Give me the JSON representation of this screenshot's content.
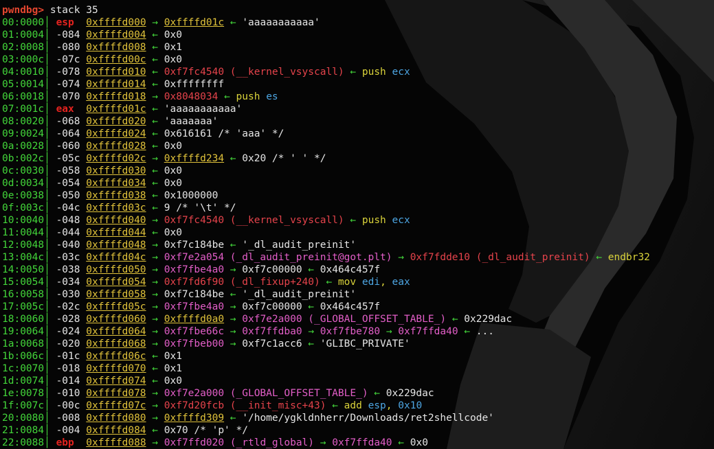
{
  "prompt": "pwndbg>",
  "command": "stack 35",
  "rows": [
    {
      "idx": "00:0000",
      "reg": "esp",
      "off": "",
      "addr": "0xffffd000",
      "chain": [
        {
          "t": " "
        },
        {
          "t": "→",
          "c": "arrow"
        },
        {
          "t": " "
        },
        {
          "t": "0xffffd01c",
          "c": "addr"
        },
        {
          "t": " "
        },
        {
          "t": "←",
          "c": "arrow"
        },
        {
          "t": " 'aaaaaaaaaaa'",
          "c": "val"
        }
      ]
    },
    {
      "idx": "01:0004",
      "reg": "",
      "off": "-084",
      "addr": "0xffffd004",
      "chain": [
        {
          "t": " "
        },
        {
          "t": "←",
          "c": "arrow"
        },
        {
          "t": " 0x0",
          "c": "val"
        }
      ]
    },
    {
      "idx": "02:0008",
      "reg": "",
      "off": "-080",
      "addr": "0xffffd008",
      "chain": [
        {
          "t": " "
        },
        {
          "t": "←",
          "c": "arrow"
        },
        {
          "t": " 0x1",
          "c": "val"
        }
      ]
    },
    {
      "idx": "03:000c",
      "reg": "",
      "off": "-07c",
      "addr": "0xffffd00c",
      "chain": [
        {
          "t": " "
        },
        {
          "t": "←",
          "c": "arrow"
        },
        {
          "t": " 0x0",
          "c": "val"
        }
      ]
    },
    {
      "idx": "04:0010",
      "reg": "",
      "off": "-078",
      "addr": "0xffffd010",
      "chain": [
        {
          "t": " "
        },
        {
          "t": "←",
          "c": "arrow"
        },
        {
          "t": " "
        },
        {
          "t": "0xf7fc4540 (__kernel_vsyscall)",
          "c": "ptr-r"
        },
        {
          "t": " "
        },
        {
          "t": "←",
          "c": "arrow"
        },
        {
          "t": " push ",
          "c": "instr"
        },
        {
          "t": "ecx",
          "c": "regop"
        }
      ]
    },
    {
      "idx": "05:0014",
      "reg": "",
      "off": "-074",
      "addr": "0xffffd014",
      "chain": [
        {
          "t": " "
        },
        {
          "t": "←",
          "c": "arrow"
        },
        {
          "t": " 0xffffffff",
          "c": "val"
        }
      ]
    },
    {
      "idx": "06:0018",
      "reg": "",
      "off": "-070",
      "addr": "0xffffd018",
      "chain": [
        {
          "t": " "
        },
        {
          "t": "→",
          "c": "arrow"
        },
        {
          "t": " "
        },
        {
          "t": "0x8048034",
          "c": "ptr-r"
        },
        {
          "t": " "
        },
        {
          "t": "←",
          "c": "arrow"
        },
        {
          "t": " push ",
          "c": "instr"
        },
        {
          "t": "es",
          "c": "regop"
        }
      ]
    },
    {
      "idx": "07:001c",
      "reg": "eax",
      "off": "",
      "addr": "0xffffd01c",
      "chain": [
        {
          "t": " "
        },
        {
          "t": "←",
          "c": "arrow"
        },
        {
          "t": " 'aaaaaaaaaaa'",
          "c": "val"
        }
      ]
    },
    {
      "idx": "08:0020",
      "reg": "",
      "off": "-068",
      "addr": "0xffffd020",
      "chain": [
        {
          "t": " "
        },
        {
          "t": "←",
          "c": "arrow"
        },
        {
          "t": " 'aaaaaaa'",
          "c": "val"
        }
      ]
    },
    {
      "idx": "09:0024",
      "reg": "",
      "off": "-064",
      "addr": "0xffffd024",
      "chain": [
        {
          "t": " "
        },
        {
          "t": "←",
          "c": "arrow"
        },
        {
          "t": " 0x616161 /* 'aaa' */",
          "c": "val"
        }
      ]
    },
    {
      "idx": "0a:0028",
      "reg": "",
      "off": "-060",
      "addr": "0xffffd028",
      "chain": [
        {
          "t": " "
        },
        {
          "t": "←",
          "c": "arrow"
        },
        {
          "t": " 0x0",
          "c": "val"
        }
      ]
    },
    {
      "idx": "0b:002c",
      "reg": "",
      "off": "-05c",
      "addr": "0xffffd02c",
      "chain": [
        {
          "t": " "
        },
        {
          "t": "→",
          "c": "arrow"
        },
        {
          "t": " "
        },
        {
          "t": "0xffffd234",
          "c": "addr"
        },
        {
          "t": " "
        },
        {
          "t": "←",
          "c": "arrow"
        },
        {
          "t": " 0x20 /* ' ' */",
          "c": "val"
        }
      ]
    },
    {
      "idx": "0c:0030",
      "reg": "",
      "off": "-058",
      "addr": "0xffffd030",
      "chain": [
        {
          "t": " "
        },
        {
          "t": "←",
          "c": "arrow"
        },
        {
          "t": " 0x0",
          "c": "val"
        }
      ]
    },
    {
      "idx": "0d:0034",
      "reg": "",
      "off": "-054",
      "addr": "0xffffd034",
      "chain": [
        {
          "t": " "
        },
        {
          "t": "←",
          "c": "arrow"
        },
        {
          "t": " 0x0",
          "c": "val"
        }
      ]
    },
    {
      "idx": "0e:0038",
      "reg": "",
      "off": "-050",
      "addr": "0xffffd038",
      "chain": [
        {
          "t": " "
        },
        {
          "t": "←",
          "c": "arrow"
        },
        {
          "t": " 0x1000000",
          "c": "val"
        }
      ]
    },
    {
      "idx": "0f:003c",
      "reg": "",
      "off": "-04c",
      "addr": "0xffffd03c",
      "chain": [
        {
          "t": " "
        },
        {
          "t": "←",
          "c": "arrow"
        },
        {
          "t": " 9 /* '\\t' */",
          "c": "val"
        }
      ]
    },
    {
      "idx": "10:0040",
      "reg": "",
      "off": "-048",
      "addr": "0xffffd040",
      "chain": [
        {
          "t": " "
        },
        {
          "t": "→",
          "c": "arrow"
        },
        {
          "t": " "
        },
        {
          "t": "0xf7fc4540 (__kernel_vsyscall)",
          "c": "ptr-r"
        },
        {
          "t": " "
        },
        {
          "t": "←",
          "c": "arrow"
        },
        {
          "t": " push ",
          "c": "instr"
        },
        {
          "t": "ecx",
          "c": "regop"
        }
      ]
    },
    {
      "idx": "11:0044",
      "reg": "",
      "off": "-044",
      "addr": "0xffffd044",
      "chain": [
        {
          "t": " "
        },
        {
          "t": "←",
          "c": "arrow"
        },
        {
          "t": " 0x0",
          "c": "val"
        }
      ]
    },
    {
      "idx": "12:0048",
      "reg": "",
      "off": "-040",
      "addr": "0xffffd048",
      "chain": [
        {
          "t": " "
        },
        {
          "t": "→",
          "c": "arrow"
        },
        {
          "t": " 0xf7c184be ",
          "c": "val"
        },
        {
          "t": "←",
          "c": "arrow"
        },
        {
          "t": " '_dl_audit_preinit'",
          "c": "val"
        }
      ]
    },
    {
      "idx": "13:004c",
      "reg": "",
      "off": "-03c",
      "addr": "0xffffd04c",
      "chain": [
        {
          "t": " "
        },
        {
          "t": "→",
          "c": "arrow"
        },
        {
          "t": " "
        },
        {
          "t": "0xf7e2a054 (_dl_audit_preinit@got.plt)",
          "c": "ptr-m"
        },
        {
          "t": " "
        },
        {
          "t": "→",
          "c": "arrow"
        },
        {
          "t": " "
        },
        {
          "t": "0xf7fdde10 (_dl_audit_preinit)",
          "c": "ptr-r"
        },
        {
          "t": " "
        },
        {
          "t": "←",
          "c": "arrow"
        },
        {
          "t": " endbr32",
          "c": "instr"
        }
      ]
    },
    {
      "idx": "14:0050",
      "reg": "",
      "off": "-038",
      "addr": "0xffffd050",
      "chain": [
        {
          "t": " "
        },
        {
          "t": "→",
          "c": "arrow"
        },
        {
          "t": " "
        },
        {
          "t": "0xf7fbe4a0",
          "c": "ptr-m"
        },
        {
          "t": " "
        },
        {
          "t": "→",
          "c": "arrow"
        },
        {
          "t": " 0xf7c00000 ",
          "c": "val"
        },
        {
          "t": "←",
          "c": "arrow"
        },
        {
          "t": " 0x464c457f",
          "c": "val"
        }
      ]
    },
    {
      "idx": "15:0054",
      "reg": "",
      "off": "-034",
      "addr": "0xffffd054",
      "chain": [
        {
          "t": " "
        },
        {
          "t": "→",
          "c": "arrow"
        },
        {
          "t": " "
        },
        {
          "t": "0xf7fd6f90 (_dl_fixup+240)",
          "c": "ptr-r"
        },
        {
          "t": " "
        },
        {
          "t": "←",
          "c": "arrow"
        },
        {
          "t": " mov ",
          "c": "instr"
        },
        {
          "t": "edi",
          "c": "regop"
        },
        {
          "t": ", ",
          "c": "instr"
        },
        {
          "t": "eax",
          "c": "regop"
        }
      ]
    },
    {
      "idx": "16:0058",
      "reg": "",
      "off": "-030",
      "addr": "0xffffd058",
      "chain": [
        {
          "t": " "
        },
        {
          "t": "→",
          "c": "arrow"
        },
        {
          "t": " 0xf7c184be ",
          "c": "val"
        },
        {
          "t": "←",
          "c": "arrow"
        },
        {
          "t": " '_dl_audit_preinit'",
          "c": "val"
        }
      ]
    },
    {
      "idx": "17:005c",
      "reg": "",
      "off": "-02c",
      "addr": "0xffffd05c",
      "chain": [
        {
          "t": " "
        },
        {
          "t": "→",
          "c": "arrow"
        },
        {
          "t": " "
        },
        {
          "t": "0xf7fbe4a0",
          "c": "ptr-m"
        },
        {
          "t": " "
        },
        {
          "t": "→",
          "c": "arrow"
        },
        {
          "t": " 0xf7c00000 ",
          "c": "val"
        },
        {
          "t": "←",
          "c": "arrow"
        },
        {
          "t": " 0x464c457f",
          "c": "val"
        }
      ]
    },
    {
      "idx": "18:0060",
      "reg": "",
      "off": "-028",
      "addr": "0xffffd060",
      "chain": [
        {
          "t": " "
        },
        {
          "t": "→",
          "c": "arrow"
        },
        {
          "t": " "
        },
        {
          "t": "0xffffd0a0",
          "c": "addr"
        },
        {
          "t": " "
        },
        {
          "t": "→",
          "c": "arrow"
        },
        {
          "t": " "
        },
        {
          "t": "0xf7e2a000 (_GLOBAL_OFFSET_TABLE_)",
          "c": "ptr-m"
        },
        {
          "t": " "
        },
        {
          "t": "←",
          "c": "arrow"
        },
        {
          "t": " 0x229dac",
          "c": "val"
        }
      ]
    },
    {
      "idx": "19:0064",
      "reg": "",
      "off": "-024",
      "addr": "0xffffd064",
      "chain": [
        {
          "t": " "
        },
        {
          "t": "→",
          "c": "arrow"
        },
        {
          "t": " "
        },
        {
          "t": "0xf7fbe66c",
          "c": "ptr-m"
        },
        {
          "t": " "
        },
        {
          "t": "→",
          "c": "arrow"
        },
        {
          "t": " "
        },
        {
          "t": "0xf7ffdba0",
          "c": "ptr-m"
        },
        {
          "t": " "
        },
        {
          "t": "→",
          "c": "arrow"
        },
        {
          "t": " "
        },
        {
          "t": "0xf7fbe780",
          "c": "ptr-m"
        },
        {
          "t": " "
        },
        {
          "t": "→",
          "c": "arrow"
        },
        {
          "t": " "
        },
        {
          "t": "0xf7ffda40",
          "c": "ptr-m"
        },
        {
          "t": " "
        },
        {
          "t": "←",
          "c": "arrow"
        },
        {
          "t": " ...",
          "c": "val"
        }
      ]
    },
    {
      "idx": "1a:0068",
      "reg": "",
      "off": "-020",
      "addr": "0xffffd068",
      "chain": [
        {
          "t": " "
        },
        {
          "t": "→",
          "c": "arrow"
        },
        {
          "t": " "
        },
        {
          "t": "0xf7fbeb00",
          "c": "ptr-m"
        },
        {
          "t": " "
        },
        {
          "t": "→",
          "c": "arrow"
        },
        {
          "t": " 0xf7c1acc6 ",
          "c": "val"
        },
        {
          "t": "←",
          "c": "arrow"
        },
        {
          "t": " 'GLIBC_PRIVATE'",
          "c": "val"
        }
      ]
    },
    {
      "idx": "1b:006c",
      "reg": "",
      "off": "-01c",
      "addr": "0xffffd06c",
      "chain": [
        {
          "t": " "
        },
        {
          "t": "←",
          "c": "arrow"
        },
        {
          "t": " 0x1",
          "c": "val"
        }
      ]
    },
    {
      "idx": "1c:0070",
      "reg": "",
      "off": "-018",
      "addr": "0xffffd070",
      "chain": [
        {
          "t": " "
        },
        {
          "t": "←",
          "c": "arrow"
        },
        {
          "t": " 0x1",
          "c": "val"
        }
      ]
    },
    {
      "idx": "1d:0074",
      "reg": "",
      "off": "-014",
      "addr": "0xffffd074",
      "chain": [
        {
          "t": " "
        },
        {
          "t": "←",
          "c": "arrow"
        },
        {
          "t": " 0x0",
          "c": "val"
        }
      ]
    },
    {
      "idx": "1e:0078",
      "reg": "",
      "off": "-010",
      "addr": "0xffffd078",
      "chain": [
        {
          "t": " "
        },
        {
          "t": "→",
          "c": "arrow"
        },
        {
          "t": " "
        },
        {
          "t": "0xf7e2a000 (_GLOBAL_OFFSET_TABLE_)",
          "c": "ptr-m"
        },
        {
          "t": " "
        },
        {
          "t": "←",
          "c": "arrow"
        },
        {
          "t": " 0x229dac",
          "c": "val"
        }
      ]
    },
    {
      "idx": "1f:007c",
      "reg": "",
      "off": "-00c",
      "addr": "0xffffd07c",
      "chain": [
        {
          "t": " "
        },
        {
          "t": "→",
          "c": "arrow"
        },
        {
          "t": " "
        },
        {
          "t": "0xf7d20fcb (__init_misc+43)",
          "c": "ptr-r"
        },
        {
          "t": " "
        },
        {
          "t": "←",
          "c": "arrow"
        },
        {
          "t": " add ",
          "c": "instr"
        },
        {
          "t": "esp",
          "c": "regop"
        },
        {
          "t": ", ",
          "c": "instr"
        },
        {
          "t": "0x10",
          "c": "hexop"
        }
      ]
    },
    {
      "idx": "20:0080",
      "reg": "",
      "off": "-008",
      "addr": "0xffffd080",
      "chain": [
        {
          "t": " "
        },
        {
          "t": "→",
          "c": "arrow"
        },
        {
          "t": " "
        },
        {
          "t": "0xffffd309",
          "c": "addr"
        },
        {
          "t": " "
        },
        {
          "t": "←",
          "c": "arrow"
        },
        {
          "t": " '/home/ygkldnherr/Downloads/ret2shellcode'",
          "c": "val"
        }
      ]
    },
    {
      "idx": "21:0084",
      "reg": "",
      "off": "-004",
      "addr": "0xffffd084",
      "chain": [
        {
          "t": " "
        },
        {
          "t": "←",
          "c": "arrow"
        },
        {
          "t": " 0x70 /* 'p' */",
          "c": "val"
        }
      ]
    },
    {
      "idx": "22:0088",
      "reg": "ebp",
      "off": "",
      "addr": "0xffffd088",
      "chain": [
        {
          "t": " "
        },
        {
          "t": "→",
          "c": "arrow"
        },
        {
          "t": " "
        },
        {
          "t": "0xf7ffd020 (_rtld_global)",
          "c": "ptr-m"
        },
        {
          "t": " "
        },
        {
          "t": "→",
          "c": "arrow"
        },
        {
          "t": " "
        },
        {
          "t": "0xf7ffda40",
          "c": "ptr-m"
        },
        {
          "t": " "
        },
        {
          "t": "←",
          "c": "arrow"
        },
        {
          "t": " 0x0",
          "c": "val"
        }
      ]
    }
  ]
}
